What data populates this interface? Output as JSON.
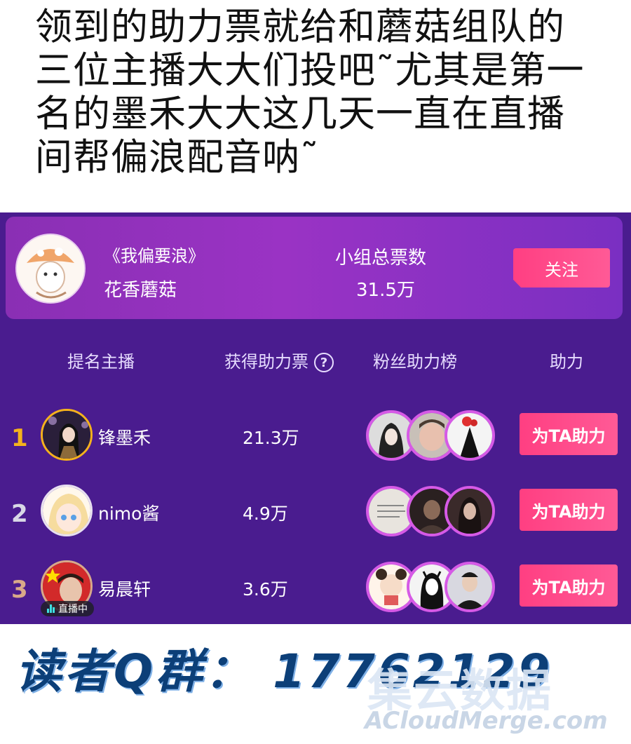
{
  "caption": {
    "lines": [
      "领到的助力票就给和蘑菇组队的",
      "三位主播大大们投吧˜尤其是第一",
      "名的墨禾大大这几天一直在直播",
      "间帮偏浪配音呐˜"
    ]
  },
  "team": {
    "title": "《我偏要浪》",
    "name": "花香蘑菇",
    "total_label": "小组总票数",
    "total_value": "31.5万",
    "follow_label": "关注"
  },
  "columns": {
    "anchor": "提名主播",
    "votes": "获得助力票",
    "fans": "粉丝助力榜",
    "boost": "助力"
  },
  "rows": [
    {
      "rank": "1",
      "name": "锋墨禾",
      "votes": "21.3万",
      "boost_label": "为TA助力",
      "rank_color": "#f5b21c"
    },
    {
      "rank": "2",
      "name": "nimo酱",
      "votes": "4.9万",
      "boost_label": "为TA助力",
      "rank_color": "#d8d8e6"
    },
    {
      "rank": "3",
      "name": "易晨轩",
      "votes": "3.6万",
      "boost_label": "为TA助力",
      "rank_color": "#d9a989",
      "live_label": "直播中"
    }
  ],
  "footer": {
    "qq_group": "读者Q群：  17762129",
    "watermark_cn": "集云数据",
    "watermark_en": "ACloudMerge.com"
  },
  "colors": {
    "panel": "#4a1c8f",
    "accent_pink": "#ff4a8c",
    "fan_ring": "#d65ae6",
    "footer_blue": "#0c3f78"
  }
}
